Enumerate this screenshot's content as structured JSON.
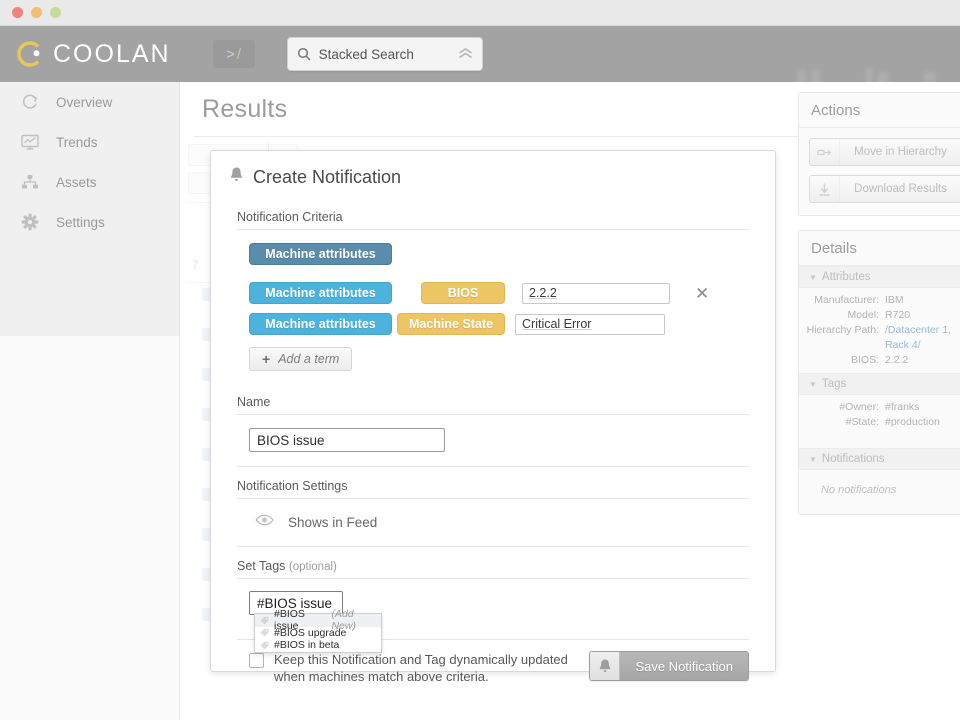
{
  "window": {
    "traffic_lights": [
      "close",
      "minimize",
      "zoom"
    ]
  },
  "header": {
    "brand": "COOLAN",
    "brand_icon": "coolan-logo-icon",
    "console_icon": "prompt-slash-icon",
    "console_symbol": ">",
    "console_slash": "/",
    "search": {
      "label": "Stacked Search",
      "placeholder": "Stacked Search",
      "icon": "search-icon",
      "expand_icon": "chevron-double-up-icon"
    }
  },
  "sidebar": {
    "items": [
      {
        "label": "Overview",
        "icon": "refresh-circle-icon"
      },
      {
        "label": "Trends",
        "icon": "chart-monitor-icon"
      },
      {
        "label": "Assets",
        "icon": "hierarchy-nodes-icon"
      },
      {
        "label": "Settings",
        "icon": "gear-icon"
      }
    ]
  },
  "main": {
    "page_title": "Results",
    "background_count": "7"
  },
  "modal": {
    "title": "Create Notification",
    "title_icon": "bell-icon",
    "criteria": {
      "section_label": "Notification Criteria",
      "primary_tag": "Machine attributes",
      "rows": [
        {
          "attribute_tag": "Machine attributes",
          "field_tag": "BIOS",
          "value": "2.2.2",
          "remove_icon": "close-x-icon"
        },
        {
          "attribute_tag": "Machine attributes",
          "field_tag": "Machine State",
          "value": "Critical Error"
        }
      ],
      "add_term_label": "Add a term",
      "add_term_icon": "plus-icon"
    },
    "name": {
      "section_label": "Name",
      "value": "BIOS issue",
      "placeholder": "BIOS issue"
    },
    "settings": {
      "section_label": "Notification Settings",
      "feed_label": "Shows in Feed",
      "feed_icon": "eye-icon"
    },
    "tags": {
      "section_label": "Set Tags",
      "section_label_optional": "(optional)",
      "input_value": "#BIOS issue",
      "placeholder": "#BIOS issue",
      "suggestions": [
        {
          "label": "#BIOS issue",
          "hint": "(Add New)",
          "icon": "tag-icon",
          "active": true
        },
        {
          "label": "#BIOS upgrade",
          "hint": "",
          "icon": "tag-icon",
          "active": false
        },
        {
          "label": "#BIOS in beta",
          "hint": "",
          "icon": "tag-icon",
          "active": false
        }
      ]
    },
    "footer": {
      "checkbox_checked": false,
      "checkbox_text": "Keep this Notification and Tag dynamically updated when machines match above criteria.",
      "save_label": "Save Notification",
      "save_icon": "bell-icon"
    }
  },
  "rail": {
    "actions": {
      "title": "Actions",
      "buttons": [
        {
          "label": "Move in Hierarchy",
          "icon": "move-hierarchy-icon"
        },
        {
          "label": "Download Results",
          "icon": "download-icon"
        }
      ]
    },
    "details": {
      "title": "Details",
      "sections": [
        {
          "name": "Attributes",
          "caret_icon": "caret-down-icon",
          "rows": [
            {
              "key": "Manufacturer:",
              "value": "IBM",
              "link": false
            },
            {
              "key": "Model:",
              "value": "R720",
              "link": false
            },
            {
              "key": "Hierarchy Path:",
              "value": "/Datacenter 1,",
              "link": true
            },
            {
              "key": "",
              "value": "Rack 4/",
              "link": true
            },
            {
              "key": "BIOS:",
              "value": "2.2.2",
              "link": false
            }
          ]
        },
        {
          "name": "Tags",
          "caret_icon": "caret-down-icon",
          "rows": [
            {
              "key": "#Owner:",
              "value": "#franks",
              "link": false
            },
            {
              "key": "#State:",
              "value": "#production",
              "link": false
            }
          ]
        },
        {
          "name": "Notifications",
          "caret_icon": "caret-down-icon",
          "empty": "No notifications",
          "rows": []
        }
      ]
    }
  },
  "colors": {
    "appbar": "#a3a3a3",
    "tag_blue_dark": "#5a8cab",
    "tag_blue": "#4db3dd",
    "tag_amber": "#eec565",
    "brand_gold": "#e8c75a",
    "link": "#9ab8d8"
  }
}
